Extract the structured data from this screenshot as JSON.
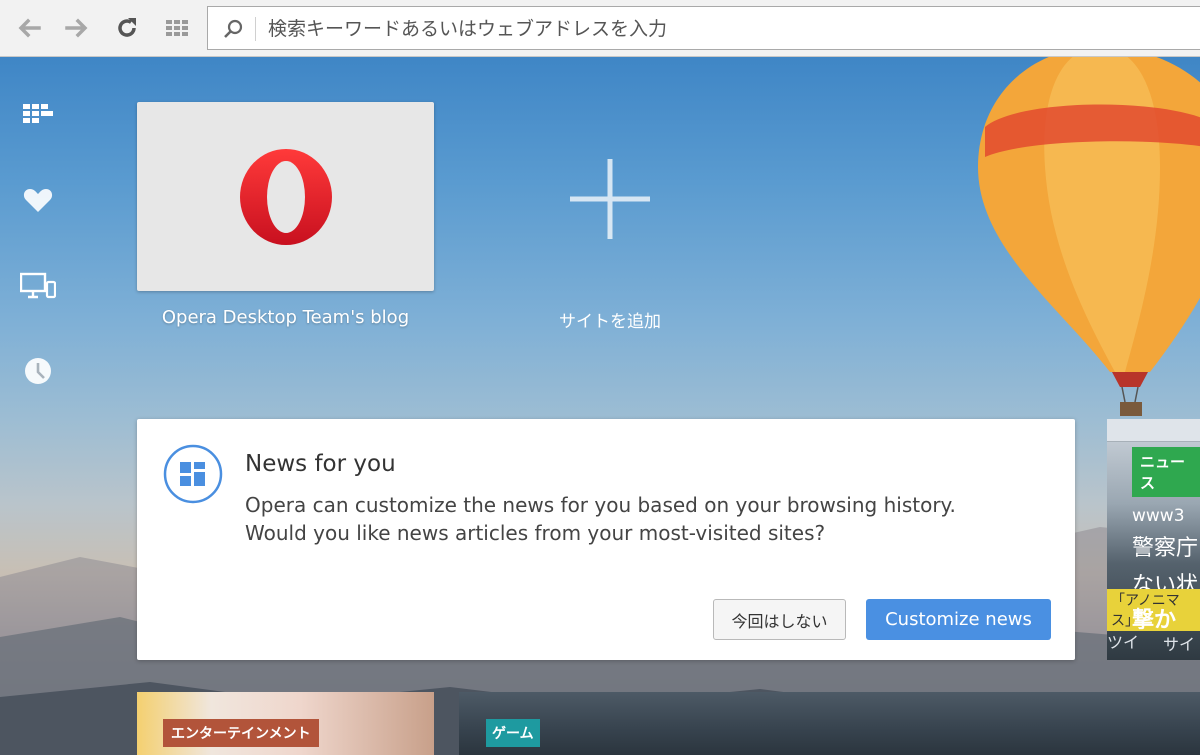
{
  "toolbar": {
    "back_icon": "back-arrow-icon",
    "forward_icon": "forward-arrow-icon",
    "reload_icon": "reload-icon",
    "tab_grid_icon": "tab-grid-icon",
    "address": {
      "value": "",
      "placeholder": "検索キーワードあるいはウェブアドレスを入力",
      "icon": "search-icon"
    }
  },
  "sidebar": {
    "items": [
      {
        "name": "speed-dial",
        "icon": "grid-icon"
      },
      {
        "name": "bookmarks",
        "icon": "heart-icon"
      },
      {
        "name": "synced-devices",
        "icon": "devices-icon"
      },
      {
        "name": "history",
        "icon": "clock-icon"
      }
    ]
  },
  "speed_dial": {
    "tiles": [
      {
        "label": "Opera Desktop Team's blog",
        "icon": "opera-logo-icon"
      }
    ],
    "add_site_label": "サイトを追加"
  },
  "news_prompt": {
    "title": "News for you",
    "body_line1": "Opera can customize the news for you based on your browsing history.",
    "body_line2": "Would you like news articles from your most-visited sites?",
    "decline_label": "今回はしない",
    "accept_label": "Customize news",
    "accent_color": "#4a90e2"
  },
  "news_tiles": {
    "right": {
      "tag": "ニュース",
      "line1": "www3",
      "line2": "警察庁",
      "line3": "ない状",
      "line4": "「アノニマス」",
      "line5": "撃か",
      "line6": "ツイ",
      "line7": "サイ"
    },
    "bottom": [
      {
        "tag": "エンターテインメント",
        "tag_color": "#b2543a"
      },
      {
        "tag": "ゲーム",
        "tag_color": "#1e9aa0"
      }
    ]
  }
}
